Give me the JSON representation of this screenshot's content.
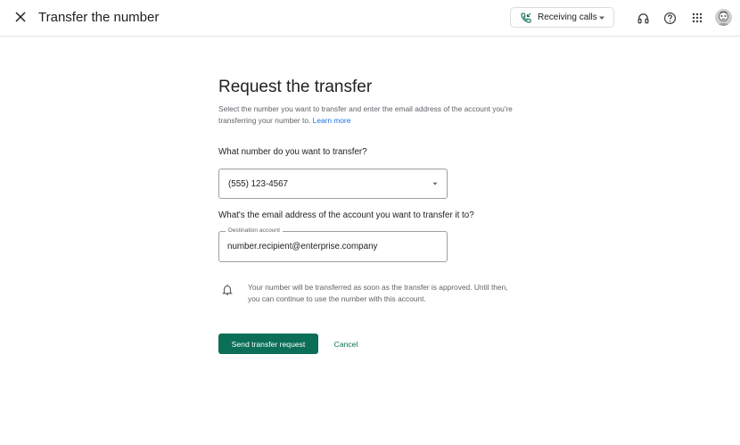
{
  "header": {
    "title": "Transfer the number",
    "close_icon": "close-icon",
    "status_chip": {
      "label": "Receiving calls",
      "icon": "phone-incoming-icon"
    },
    "icons": [
      "headset-icon",
      "help-icon",
      "apps-grid-icon"
    ],
    "avatar": "avatar"
  },
  "main": {
    "heading": "Request the transfer",
    "intro": "Select the number you want to transfer and enter the email address of the account you're transferring your number to.",
    "learn_more": "Learn more",
    "question_number": "What number do you want to transfer?",
    "selected_number": "(555) 123-4567",
    "question_email": "What's the email address of the account you want to transfer it to?",
    "destination_label": "Destination account",
    "destination_value": "number.recipient@enterprise.company",
    "notice": "Your number will be transferred as soon as the transfer is approved. Until then, you can continue to use the number with this account.",
    "send_button": "Send transfer request",
    "cancel_button": "Cancel"
  },
  "colors": {
    "accent": "#0b6e57",
    "link": "#1a73e8",
    "text": "#202124",
    "muted_text": "#5f6368"
  }
}
